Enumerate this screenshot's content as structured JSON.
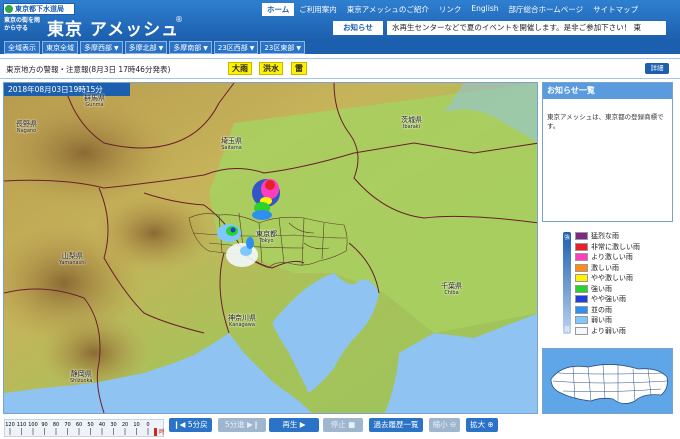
{
  "header": {
    "bureau": "東京都下水道局",
    "tagline": "東京の街を雨から守る",
    "brand": "東京 アメッシュ",
    "brand_mark": "®",
    "nav": [
      {
        "label": "ホーム",
        "active": true
      },
      {
        "label": "ご利用案内",
        "active": false
      },
      {
        "label": "東京アメッシュのご紹介",
        "active": false
      },
      {
        "label": "リンク",
        "active": false
      },
      {
        "label": "English",
        "active": false
      },
      {
        "label": "部庁総合ホームページ",
        "active": false
      },
      {
        "label": "サイトマップ",
        "active": false
      }
    ],
    "notice_label": "お知らせ",
    "ticker": "水再生センターなどで夏のイベントを開催します。是非ご参加下さい！ 東"
  },
  "area_tabs": [
    {
      "label": "全域表示",
      "dropdown": false
    },
    {
      "label": "東京全域",
      "dropdown": false
    },
    {
      "label": "多摩西部",
      "dropdown": true
    },
    {
      "label": "多摩北部",
      "dropdown": true
    },
    {
      "label": "多摩南部",
      "dropdown": true
    },
    {
      "label": "23区西部",
      "dropdown": true
    },
    {
      "label": "23区東部",
      "dropdown": true
    }
  ],
  "warnings": {
    "title": "東京地方の警報・注意報(8月3日 17時46分発表)",
    "badges": [
      "大雨",
      "洪水",
      "雷"
    ],
    "badge_color": "#fff200",
    "detail_label": "詳細"
  },
  "map": {
    "timestamp": "2018年08月03日19時15分",
    "labels": [
      {
        "name": "群馬県",
        "en": "Gunma"
      },
      {
        "name": "長野県",
        "en": "Nagano"
      },
      {
        "name": "埼玉県",
        "en": "Saitama"
      },
      {
        "name": "茨城県",
        "en": "Ibaraki"
      },
      {
        "name": "東京都",
        "en": "Tokyo"
      },
      {
        "name": "山梨県",
        "en": "Yamanashi"
      },
      {
        "name": "神奈川県",
        "en": "Kanagawa"
      },
      {
        "name": "千葉県",
        "en": "Chiba"
      },
      {
        "name": "静岡県",
        "en": "Shizuoka"
      }
    ]
  },
  "news": {
    "title": "お知らせ一覧",
    "body": "東京アメッシュは、東京都の登録商標です。"
  },
  "legend": {
    "scale_top": "強",
    "scale_bottom": "弱",
    "items": [
      {
        "label": "猛烈な雨",
        "color": "#7b2a86"
      },
      {
        "label": "非常に激しい雨",
        "color": "#e8202a"
      },
      {
        "label": "より激しい雨",
        "color": "#ff3fbf"
      },
      {
        "label": "激しい雨",
        "color": "#ff8c1a"
      },
      {
        "label": "やや激しい雨",
        "color": "#fff200"
      },
      {
        "label": "強い雨",
        "color": "#2cd12c"
      },
      {
        "label": "やや強い雨",
        "color": "#1f3fd8"
      },
      {
        "label": "並の雨",
        "color": "#2f8ff0"
      },
      {
        "label": "弱い雨",
        "color": "#7fc8ff"
      },
      {
        "label": "より弱い雨",
        "color": "#f4f8fc"
      }
    ]
  },
  "controls": {
    "ruler_ticks": [
      "120",
      "110",
      "100",
      "90",
      "80",
      "70",
      "60",
      "50",
      "40",
      "30",
      "20",
      "10",
      "0"
    ],
    "ruler_end": "時",
    "back5": "5分戻",
    "fwd5": "5分進",
    "play": "再生",
    "stop": "停止",
    "history": "過去履歴一覧",
    "zoom_out": "縮小",
    "zoom_in": "拡大"
  }
}
